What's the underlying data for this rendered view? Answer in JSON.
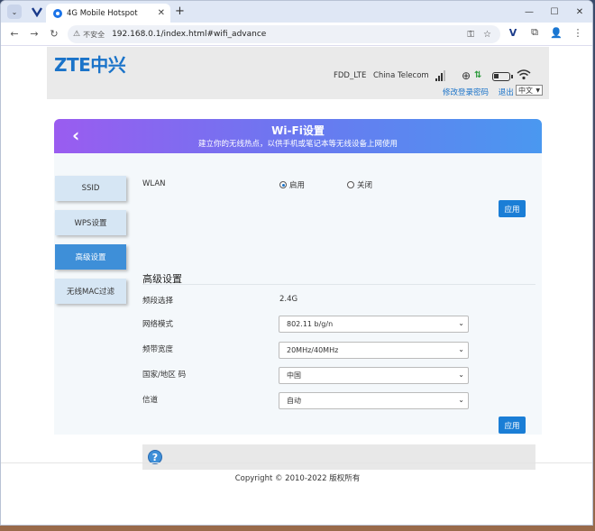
{
  "browser": {
    "tab_title": "4G Mobile Hotspot",
    "insecure_label": "不安全",
    "url": "192.168.0.1/index.html#wifi_advance"
  },
  "header": {
    "logo": "ZTE中兴",
    "network_type": "FDD_LTE",
    "carrier": "China Telecom",
    "link_change_password": "修改登录密码",
    "link_logout": "退出",
    "language": "中文"
  },
  "banner": {
    "title": "Wi-Fi设置",
    "subtitle": "建立你的无线热点，以供手机或笔记本等无线设备上网使用"
  },
  "sidebar": {
    "items": [
      {
        "label": "SSID",
        "active": false
      },
      {
        "label": "WPS设置",
        "active": false
      },
      {
        "label": "高级设置",
        "active": true
      },
      {
        "label": "无线MAC过滤",
        "active": false
      }
    ]
  },
  "wlan": {
    "label": "WLAN",
    "option_on": "启用",
    "option_off": "关闭",
    "selected": "启用",
    "apply_label": "应用"
  },
  "advanced": {
    "section_title": "高级设置",
    "band_label": "频段选择",
    "band_value": "2.4G",
    "mode_label": "网络模式",
    "mode_value": "802.11 b/g/n",
    "bandwidth_label": "频带宽度",
    "bandwidth_value": "20MHz/40MHz",
    "country_label": "国家/地区 码",
    "country_value": "中国",
    "channel_label": "信道",
    "channel_value": "自动",
    "apply_label": "应用"
  },
  "footer": {
    "copyright": "Copyright © 2010-2022 版权所有"
  },
  "colors": {
    "brand": "#1a73c9",
    "active_nav": "#3e8fd8",
    "apply_button": "#1a7ed6"
  }
}
